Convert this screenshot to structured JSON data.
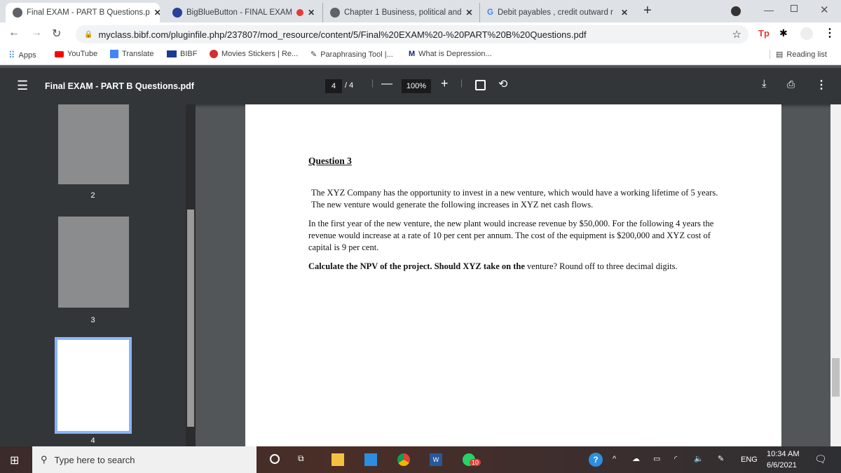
{
  "tabs": [
    {
      "title": "Final EXAM - PART B Questions.p",
      "active": true
    },
    {
      "title": "BigBlueButton - FINAL EXAM",
      "recording": true
    },
    {
      "title": "Chapter 1 Business, political and"
    },
    {
      "title": "Debit payables , credit outward r"
    }
  ],
  "address": {
    "url": "myclass.bibf.com/pluginfile.php/237807/mod_resource/content/5/Final%20EXAM%20-%20PART%20B%20Questions.pdf"
  },
  "bookmarks": [
    "Apps",
    "YouTube",
    "Translate",
    "BIBF",
    "Movies Stickers | Re...",
    "Paraphrasing Tool |...",
    "What is Depression..."
  ],
  "reading_list": "Reading list",
  "pdf": {
    "title": "Final EXAM - PART B Questions.pdf",
    "current_page": "4",
    "total_pages": "4",
    "zoom": "100%"
  },
  "thumbnails": [
    "2",
    "3",
    "4"
  ],
  "document": {
    "heading": "Question 3",
    "para1": "The XYZ Company has the opportunity to invest in a new venture, which would have a working lifetime of 5 years. The new venture would generate the following increases in XYZ net cash flows.",
    "para2": "In the first year of the new venture, the new plant would increase revenue by $50,000. For the following 4 years the revenue would increase at a rate of 10 per cent per annum. The cost of the equipment is $200,000 and XYZ cost of capital is 9 per cent.",
    "para3_bold": "Calculate the NPV of the project. Should XYZ take on the",
    "para3_rest": " venture? Round off to three decimal digits."
  },
  "taskbar": {
    "search_placeholder": "Type here to search",
    "whatsapp_badge": "10",
    "language": "ENG",
    "time": "10:34 AM",
    "date": "6/6/2021"
  }
}
